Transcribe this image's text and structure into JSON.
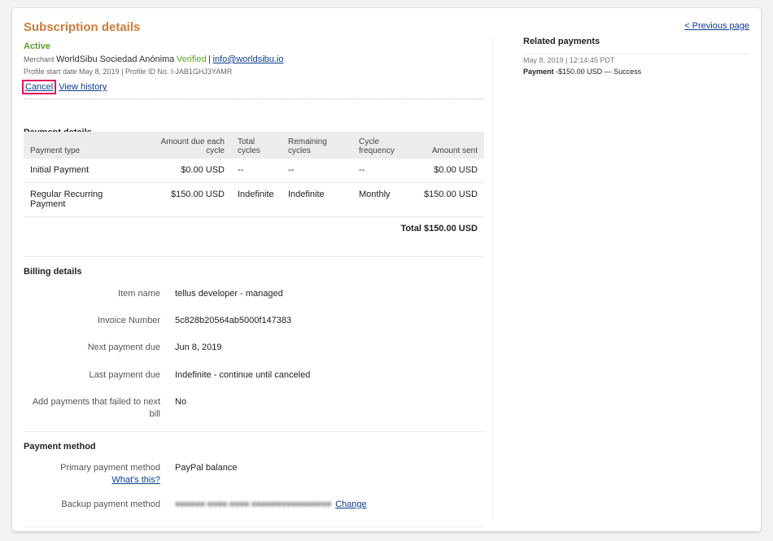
{
  "header": {
    "title": "Subscription details",
    "status": "Active",
    "merchant_label": "Merchant",
    "merchant_name": "WorldSibu Sociedad Anónima",
    "verified": "Verified",
    "separator": "|",
    "email": "info@worldsibu.io",
    "profile_line": "Profile start date May 8, 2019 | Profile ID No. I-JAB1GHJ3YAMR",
    "cancel_label": "Cancel",
    "view_history_label": "View history"
  },
  "payment_details": {
    "heading": "Payment details",
    "columns": [
      "Payment type",
      "Amount due each cycle",
      "Total cycles",
      "Remaining cycles",
      "Cycle frequency",
      "Amount sent"
    ],
    "rows": [
      [
        "Initial Payment",
        "$0.00 USD",
        "--",
        "--",
        "--",
        "$0.00 USD"
      ],
      [
        "Regular Recurring Payment",
        "$150.00 USD",
        "Indefinite",
        "Indefinite",
        "Monthly",
        "$150.00 USD"
      ]
    ],
    "total": "Total $150.00 USD"
  },
  "billing_details": {
    "heading": "Billing details",
    "item_name_label": "Item name",
    "item_name": "tellus developer - managed",
    "invoice_label": "Invoice Number",
    "invoice": "5c828b20564ab5000f147383",
    "next_due_label": "Next payment due",
    "next_due": "Jun 8, 2019",
    "last_due_label": "Last payment due",
    "last_due": "Indefinite - continue until canceled",
    "failed_label": "Add payments that failed to next bill",
    "failed": "No"
  },
  "payment_method": {
    "heading": "Payment method",
    "primary_label": "Primary payment method",
    "primary": "PayPal balance",
    "whats_this": "What's this?",
    "backup_label": "Backup payment method",
    "backup_masked": "■■■■■■ ■■■■ ■■■■ ■■■■■■■■■■■■■■■■",
    "change": "Change"
  },
  "sidebar": {
    "previous_page": "< Previous page",
    "related_heading": "Related payments",
    "payments": [
      {
        "date": "May 8, 2019 | 12:14:45 PDT",
        "type": "Payment",
        "detail": "-$150.00 USD — Success"
      }
    ]
  },
  "colors": {
    "title": "#c87d3c",
    "status": "#5c9d28",
    "link": "#0c3e8f",
    "highlight": "#e3165b"
  }
}
